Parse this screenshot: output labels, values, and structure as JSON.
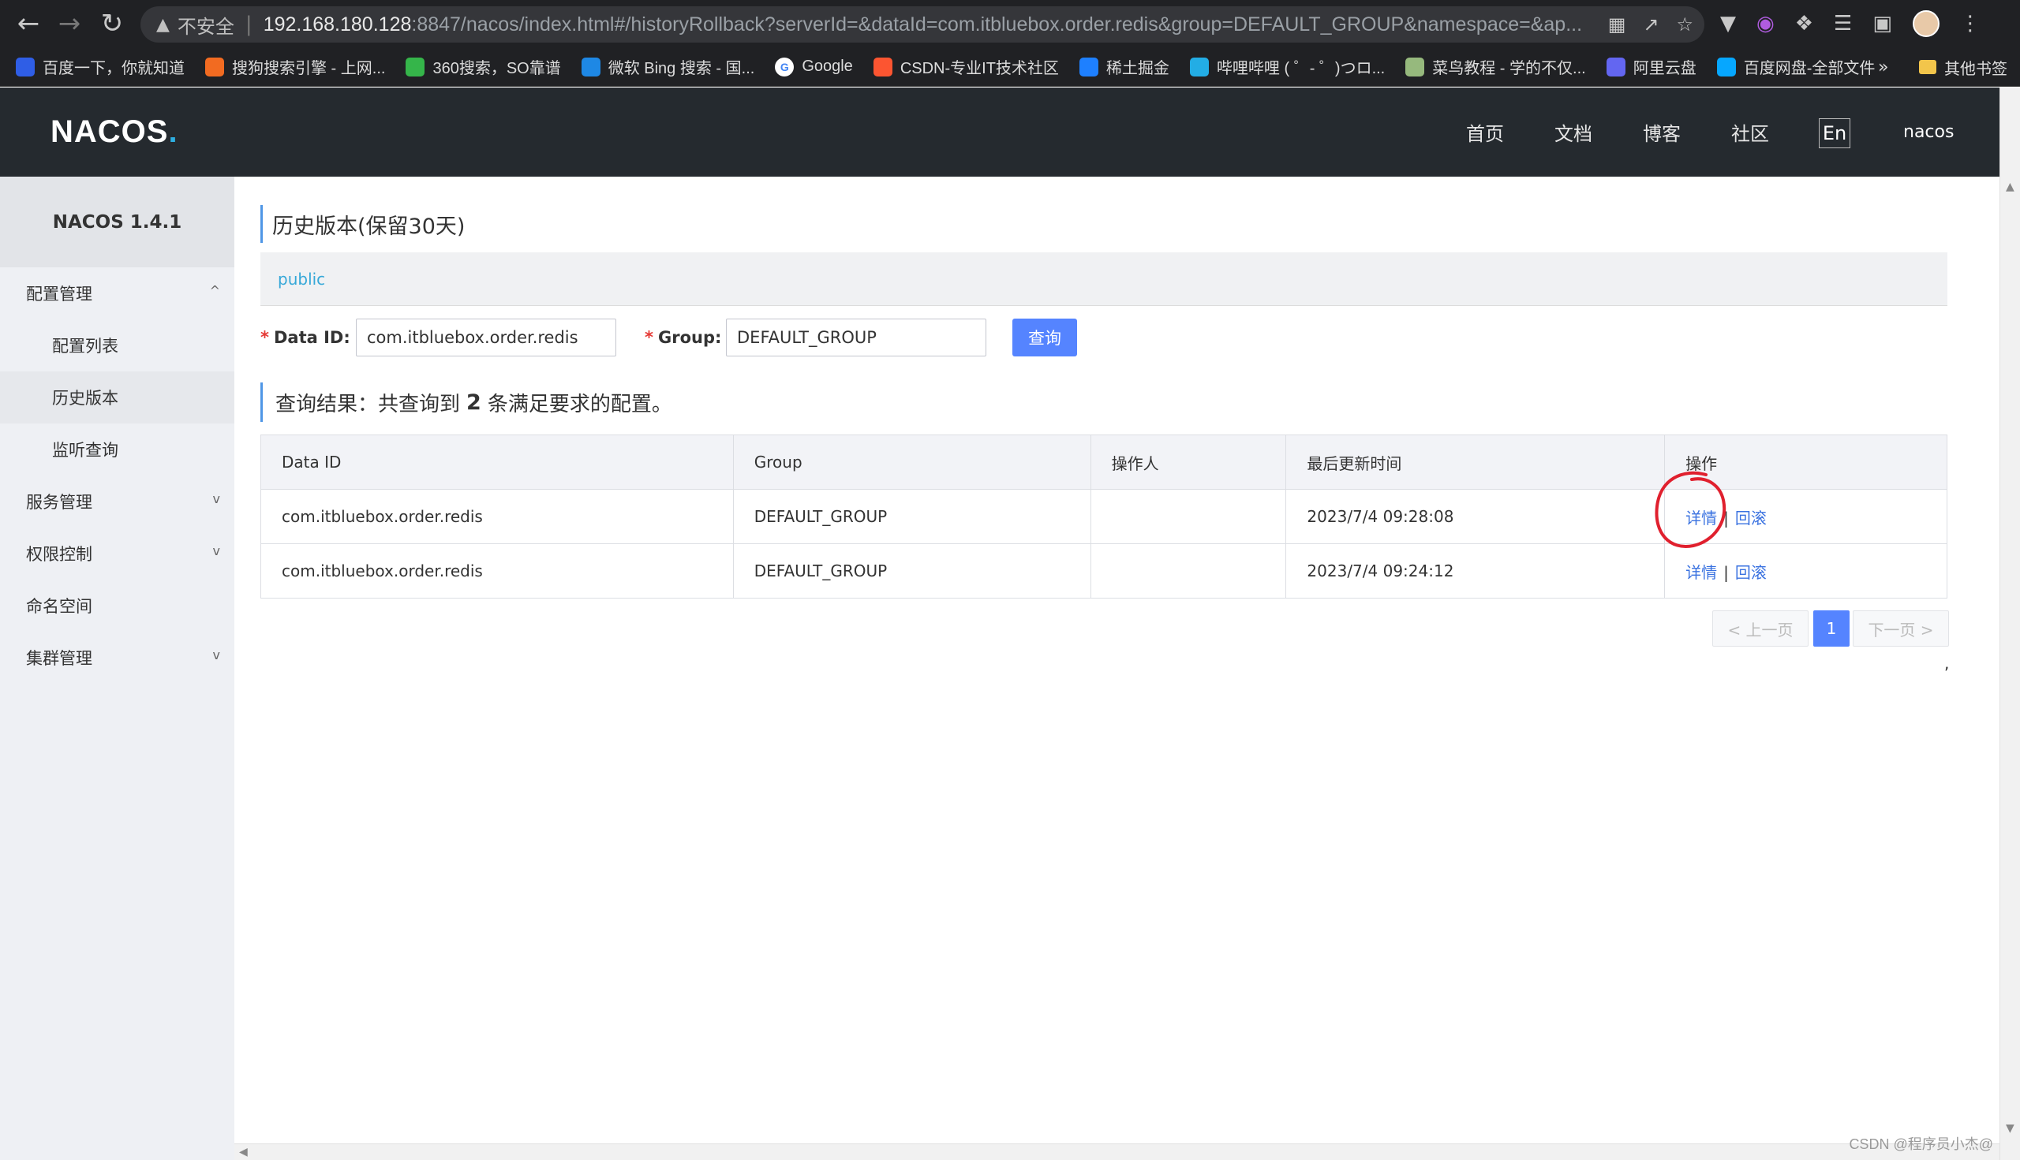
{
  "browser": {
    "insecure_label": "不安全",
    "url_host": "192.168.180.128",
    "url_rest": ":8847/nacos/index.html#/historyRollback?serverId=&dataId=com.itbluebox.order.redis&group=DEFAULT_GROUP&namespace=&ap...",
    "bookmarks": [
      {
        "label": "百度一下，你就知道",
        "icon": "baidu-icon",
        "color": "#2f5ee6"
      },
      {
        "label": "搜狗搜索引擎 - 上网...",
        "icon": "sogou-icon",
        "color": "#f26b21"
      },
      {
        "label": "360搜索，SO靠谱",
        "icon": "360-icon",
        "color": "#35b54a"
      },
      {
        "label": "微软 Bing 搜索 - 国...",
        "icon": "bing-icon",
        "color": "#1e88e5"
      },
      {
        "label": "Google",
        "icon": "google-icon",
        "color": "#ffffff"
      },
      {
        "label": "CSDN-专业IT技术社区",
        "icon": "csdn-icon",
        "color": "#fc5531"
      },
      {
        "label": "稀土掘金",
        "icon": "juejin-icon",
        "color": "#1e80ff"
      },
      {
        "label": "哔哩哔哩 ( ゜- ゜)つロ...",
        "icon": "bilibili-icon",
        "color": "#23ade5"
      },
      {
        "label": "菜鸟教程 - 学的不仅...",
        "icon": "runoob-icon",
        "color": "#96b97d"
      },
      {
        "label": "阿里云盘",
        "icon": "aliyun-drive-icon",
        "color": "#6366f1"
      },
      {
        "label": "百度网盘-全部文件",
        "icon": "baidu-pan-icon",
        "color": "#06a7ff"
      }
    ],
    "more_label": "»",
    "other_bookmarks": "其他书签"
  },
  "header": {
    "logo": "NACOS",
    "logo_dot": ".",
    "nav": [
      "首页",
      "文档",
      "博客",
      "社区"
    ],
    "lang": "En",
    "user": "nacos"
  },
  "sidebar": {
    "version": "NACOS 1.4.1",
    "items": [
      {
        "label": "配置管理",
        "chevron": "^"
      },
      {
        "label": "配置列表"
      },
      {
        "label": "历史版本"
      },
      {
        "label": "监听查询"
      },
      {
        "label": "服务管理",
        "chevron": "v"
      },
      {
        "label": "权限控制",
        "chevron": "v"
      },
      {
        "label": "命名空间"
      },
      {
        "label": "集群管理",
        "chevron": "v"
      }
    ]
  },
  "main": {
    "title": "历史版本(保留30天)",
    "namespace": "public",
    "form": {
      "dataid_label": "Data ID:",
      "dataid_value": "com.itbluebox.order.redis",
      "group_label": "Group:",
      "group_value": "DEFAULT_GROUP",
      "required_mark": "*",
      "query_button": "查询"
    },
    "result": {
      "prefix": "查询结果：共查询到",
      "count": "2",
      "suffix": "条满足要求的配置。"
    },
    "table": {
      "headers": [
        "Data ID",
        "Group",
        "操作人",
        "最后更新时间",
        "操作"
      ],
      "rows": [
        {
          "data_id": "com.itbluebox.order.redis",
          "group": "DEFAULT_GROUP",
          "operator": "",
          "updated": "2023/7/4 09:28:08",
          "detail": "详情",
          "sep": "|",
          "rollback": "回滚"
        },
        {
          "data_id": "com.itbluebox.order.redis",
          "group": "DEFAULT_GROUP",
          "operator": "",
          "updated": "2023/7/4 09:24:12",
          "detail": "详情",
          "sep": "|",
          "rollback": "回滚"
        }
      ]
    },
    "pagination": {
      "prev": "< 上一页",
      "current": "1",
      "next": "下一页 >"
    },
    "stray_mark": ","
  },
  "watermark": "CSDN @程序员小杰@",
  "colors": {
    "accent": "#5584ff",
    "link": "#3a72e0",
    "header_bg": "#252a2f",
    "annotation": "#e0202e"
  }
}
